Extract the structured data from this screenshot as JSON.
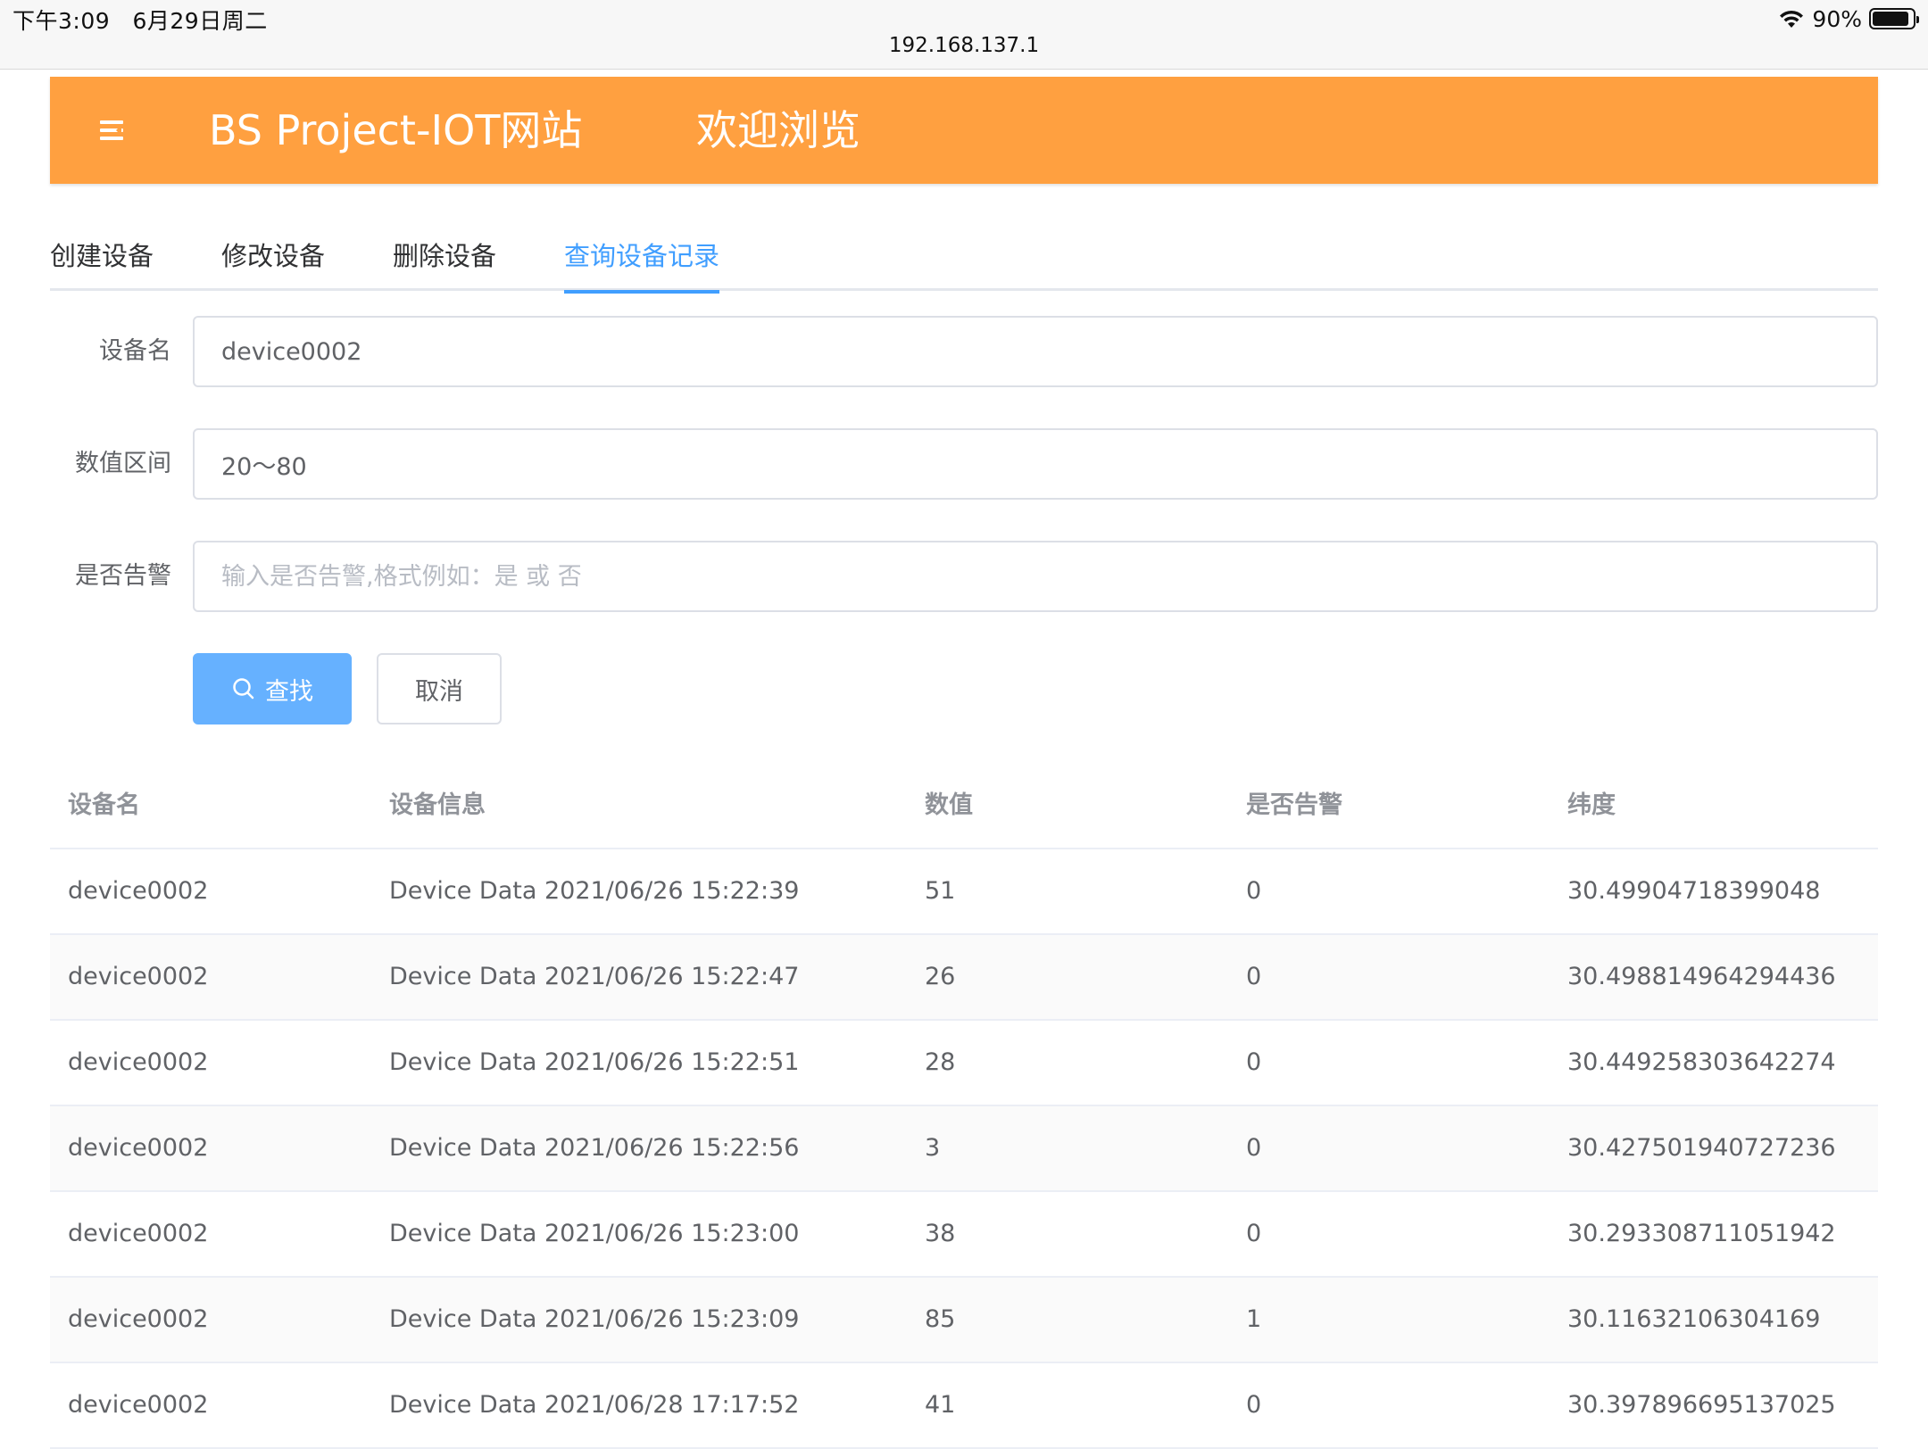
{
  "status_bar": {
    "time": "下午3:09",
    "date": "6月29日周二",
    "battery": "90%",
    "battery_level": 0.9,
    "url": "192.168.137.1"
  },
  "header": {
    "title": "BS Project-IOT网站",
    "welcome": "欢迎浏览",
    "color": "#ffa040"
  },
  "tabs": [
    {
      "label": "创建设备",
      "active": false
    },
    {
      "label": "修改设备",
      "active": false
    },
    {
      "label": "删除设备",
      "active": false
    },
    {
      "label": "查询设备记录",
      "active": true
    }
  ],
  "form": {
    "device_name": {
      "label": "设备名",
      "value": "device0002",
      "placeholder": ""
    },
    "value_range": {
      "label": "数值区间",
      "value": "20～80",
      "placeholder": ""
    },
    "alert": {
      "label": "是否告警",
      "value": "",
      "placeholder": "输入是否告警,格式例如：是 或 否"
    },
    "search_label": "查找",
    "cancel_label": "取消"
  },
  "table": {
    "columns": [
      "设备名",
      "设备信息",
      "数值",
      "是否告警",
      "纬度"
    ],
    "rows": [
      [
        "device0002",
        "Device Data 2021/06/26 15:22:39",
        "51",
        "0",
        "30.49904718399048"
      ],
      [
        "device0002",
        "Device Data 2021/06/26 15:22:47",
        "26",
        "0",
        "30.498814964294436"
      ],
      [
        "device0002",
        "Device Data 2021/06/26 15:22:51",
        "28",
        "0",
        "30.449258303642274"
      ],
      [
        "device0002",
        "Device Data 2021/06/26 15:22:56",
        "3",
        "0",
        "30.427501940727236"
      ],
      [
        "device0002",
        "Device Data 2021/06/26 15:23:00",
        "38",
        "0",
        "30.293308711051942"
      ],
      [
        "device0002",
        "Device Data 2021/06/26 15:23:09",
        "85",
        "1",
        "30.11632106304169"
      ],
      [
        "device0002",
        "Device Data 2021/06/28 17:17:52",
        "41",
        "0",
        "30.397896695137025"
      ]
    ]
  },
  "colors": {
    "accent": "#409eff",
    "primary_button": "#66b1ff"
  }
}
